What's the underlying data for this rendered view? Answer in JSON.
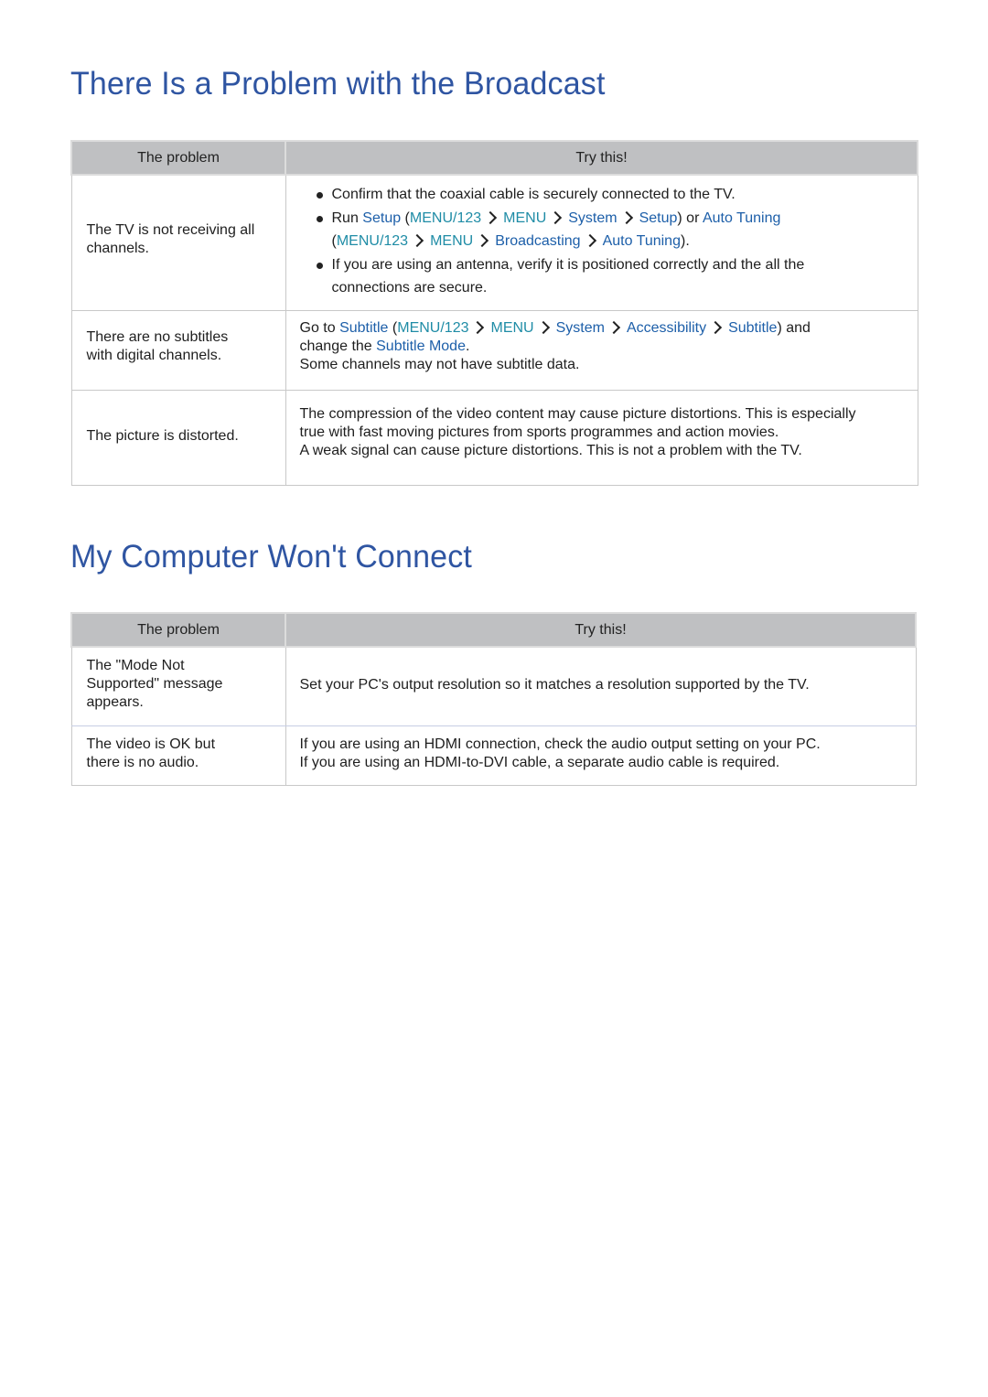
{
  "section1": {
    "title": "There Is a Problem with the Broadcast",
    "headers": {
      "problem": "The problem",
      "try": "Try this!"
    },
    "rows": [
      {
        "problem": "The TV is not receiving all channels.",
        "bullets": {
          "b1": "Confirm that the coaxial cable is securely connected to the TV.",
          "b2": {
            "run": "Run ",
            "setup": "Setup",
            "open": " (",
            "menu123": "MENU/123",
            "menu": "MENU",
            "system": "System",
            "setup2": "Setup",
            "close_or": ") or ",
            "auto_tuning": "Auto Tuning",
            "open2": "(",
            "menu123_b": "MENU/123",
            "menu_b": "MENU",
            "broadcasting": "Broadcasting",
            "auto_tuning2": "Auto Tuning",
            "close2": ")."
          },
          "b3": "If you are using an antenna, verify it is positioned correctly and the all the connections are secure."
        }
      },
      {
        "problem": "There are no subtitles with digital channels.",
        "try": {
          "go_to": "Go to ",
          "subtitle": "Subtitle",
          "open": " (",
          "menu123": "MENU/123",
          "menu": "MENU",
          "system": "System",
          "accessibility": "Accessibility",
          "subtitle2": "Subtitle",
          "and": ") and",
          "change": "change the ",
          "subtitle_mode": "Subtitle Mode",
          "period": ".",
          "line3": "Some channels may not have subtitle data."
        }
      },
      {
        "problem": "The picture is distorted.",
        "try": {
          "para1": "The compression of the video content may cause picture distortions. This is especially true with fast moving pictures from sports programmes and action movies.",
          "para2": "A weak signal can cause picture distortions. This is not a problem with the TV."
        }
      }
    ]
  },
  "section2": {
    "title": "My Computer Won't Connect",
    "headers": {
      "problem": "The problem",
      "try": "Try this!"
    },
    "rows": [
      {
        "problem": "The \"Mode Not Supported\" message appears.",
        "try": "Set your PC's output resolution so it matches a resolution supported by the TV."
      },
      {
        "problem": "The video is OK but there is no audio.",
        "try_line1": "If you are using an HDMI connection, check the audio output setting on your PC.",
        "try_line2": "If you are using an HDMI-to-DVI cable, a separate audio cable is required."
      }
    ]
  },
  "colors": {
    "heading": "#2f55a2",
    "link": "#1d5fa9",
    "menu_link": "#1f8ca6",
    "header_bg": "#bfc0c2"
  }
}
